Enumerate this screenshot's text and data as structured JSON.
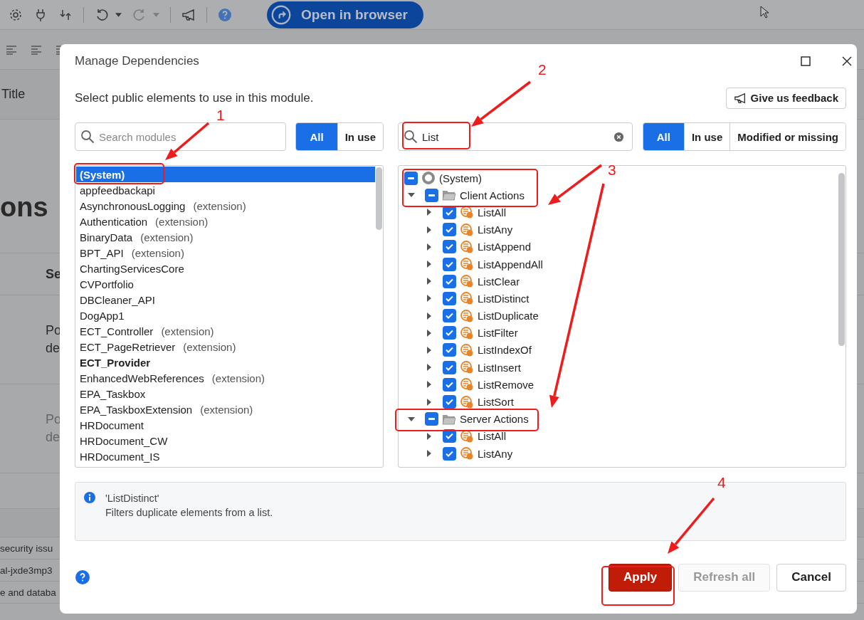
{
  "background": {
    "open_button": "Open in browser",
    "title_fragment": "Title",
    "heading_fragment": "ons",
    "column_fragment": "Se",
    "rows": [
      {
        "line_1": "Po",
        "line_2": "de",
        "dimmed": false
      },
      {
        "line_1": "Po",
        "line_2": "de",
        "dimmed": true
      }
    ],
    "list_fragments": [
      "security issu",
      "al-jxde3mp3",
      "e and databa"
    ]
  },
  "dialog": {
    "title": "Manage Dependencies",
    "subtitle": "Select public elements to use in this module.",
    "feedback_button": "Give us feedback",
    "module_search": {
      "placeholder": "Search modules"
    },
    "module_filters": [
      {
        "label": "All",
        "selected": true
      },
      {
        "label": "In use",
        "selected": false
      }
    ],
    "element_search": {
      "value": "List"
    },
    "element_filters": [
      {
        "label": "All",
        "selected": true
      },
      {
        "label": "In use",
        "selected": false
      },
      {
        "label": "Modified or missing",
        "selected": false
      }
    ],
    "modules": [
      {
        "name": "(System)",
        "selected": true,
        "bold": true
      },
      {
        "name": "appfeedbackapi",
        "selected": false,
        "bold": false
      },
      {
        "name": "AsynchronousLogging",
        "note": "(extension)",
        "selected": false,
        "bold": false
      },
      {
        "name": "Authentication",
        "note": "(extension)",
        "selected": false,
        "bold": false
      },
      {
        "name": "BinaryData",
        "note": "(extension)",
        "selected": false,
        "bold": false
      },
      {
        "name": "BPT_API",
        "note": "(extension)",
        "selected": false,
        "bold": false
      },
      {
        "name": "ChartingServicesCore",
        "selected": false,
        "bold": false
      },
      {
        "name": "CVPortfolio",
        "selected": false,
        "bold": false
      },
      {
        "name": "DBCleaner_API",
        "selected": false,
        "bold": false
      },
      {
        "name": "DogApp1",
        "selected": false,
        "bold": false
      },
      {
        "name": "ECT_Controller",
        "note": "(extension)",
        "selected": false,
        "bold": false
      },
      {
        "name": "ECT_PageRetriever",
        "note": "(extension)",
        "selected": false,
        "bold": false
      },
      {
        "name": "ECT_Provider",
        "selected": false,
        "bold": true
      },
      {
        "name": "EnhancedWebReferences",
        "note": "(extension)",
        "selected": false,
        "bold": false
      },
      {
        "name": "EPA_Taskbox",
        "selected": false,
        "bold": false
      },
      {
        "name": "EPA_TaskboxExtension",
        "note": "(extension)",
        "selected": false,
        "bold": false
      },
      {
        "name": "HRDocument",
        "selected": false,
        "bold": false
      },
      {
        "name": "HRDocument_CW",
        "selected": false,
        "bold": false
      },
      {
        "name": "HRDocument_IS",
        "selected": false,
        "bold": false
      }
    ],
    "tree": [
      {
        "label": "(System)",
        "kind": "module",
        "checked": false,
        "indeterminate": true,
        "children": [
          {
            "label": "Client Actions",
            "kind": "folder",
            "checked": false,
            "indeterminate": true,
            "expanded": true,
            "children": [
              {
                "label": "ListAll",
                "kind": "action",
                "checked": true,
                "indeterminate": false,
                "expanded": false
              },
              {
                "label": "ListAny",
                "kind": "action",
                "checked": true,
                "indeterminate": false,
                "expanded": false
              },
              {
                "label": "ListAppend",
                "kind": "action",
                "checked": true,
                "indeterminate": false,
                "expanded": false
              },
              {
                "label": "ListAppendAll",
                "kind": "action",
                "checked": true,
                "indeterminate": false,
                "expanded": false
              },
              {
                "label": "ListClear",
                "kind": "action",
                "checked": true,
                "indeterminate": false,
                "expanded": false
              },
              {
                "label": "ListDistinct",
                "kind": "action",
                "checked": true,
                "indeterminate": false,
                "expanded": false
              },
              {
                "label": "ListDuplicate",
                "kind": "action",
                "checked": true,
                "indeterminate": false,
                "expanded": false
              },
              {
                "label": "ListFilter",
                "kind": "action",
                "checked": true,
                "indeterminate": false,
                "expanded": false
              },
              {
                "label": "ListIndexOf",
                "kind": "action",
                "checked": true,
                "indeterminate": false,
                "expanded": false
              },
              {
                "label": "ListInsert",
                "kind": "action",
                "checked": true,
                "indeterminate": false,
                "expanded": false
              },
              {
                "label": "ListRemove",
                "kind": "action",
                "checked": true,
                "indeterminate": false,
                "expanded": false
              },
              {
                "label": "ListSort",
                "kind": "action",
                "checked": true,
                "indeterminate": false,
                "expanded": false
              }
            ]
          },
          {
            "label": "Server Actions",
            "kind": "folder",
            "checked": false,
            "indeterminate": true,
            "expanded": true,
            "children": [
              {
                "label": "ListAll",
                "kind": "action",
                "checked": true,
                "indeterminate": false,
                "expanded": false
              },
              {
                "label": "ListAny",
                "kind": "action",
                "checked": true,
                "indeterminate": false,
                "expanded": false
              }
            ]
          }
        ]
      }
    ],
    "info": {
      "title": "'ListDistinct'",
      "description": "Filters duplicate elements from a list."
    },
    "buttons": [
      {
        "label": "Apply",
        "kind": "primary",
        "disabled": false
      },
      {
        "label": "Refresh all",
        "kind": "secondary",
        "disabled": true
      },
      {
        "label": "Cancel",
        "kind": "secondary",
        "disabled": false
      }
    ]
  },
  "annotations": [
    {
      "label": "1"
    },
    {
      "label": "2"
    },
    {
      "label": "3"
    },
    {
      "label": "4"
    }
  ]
}
